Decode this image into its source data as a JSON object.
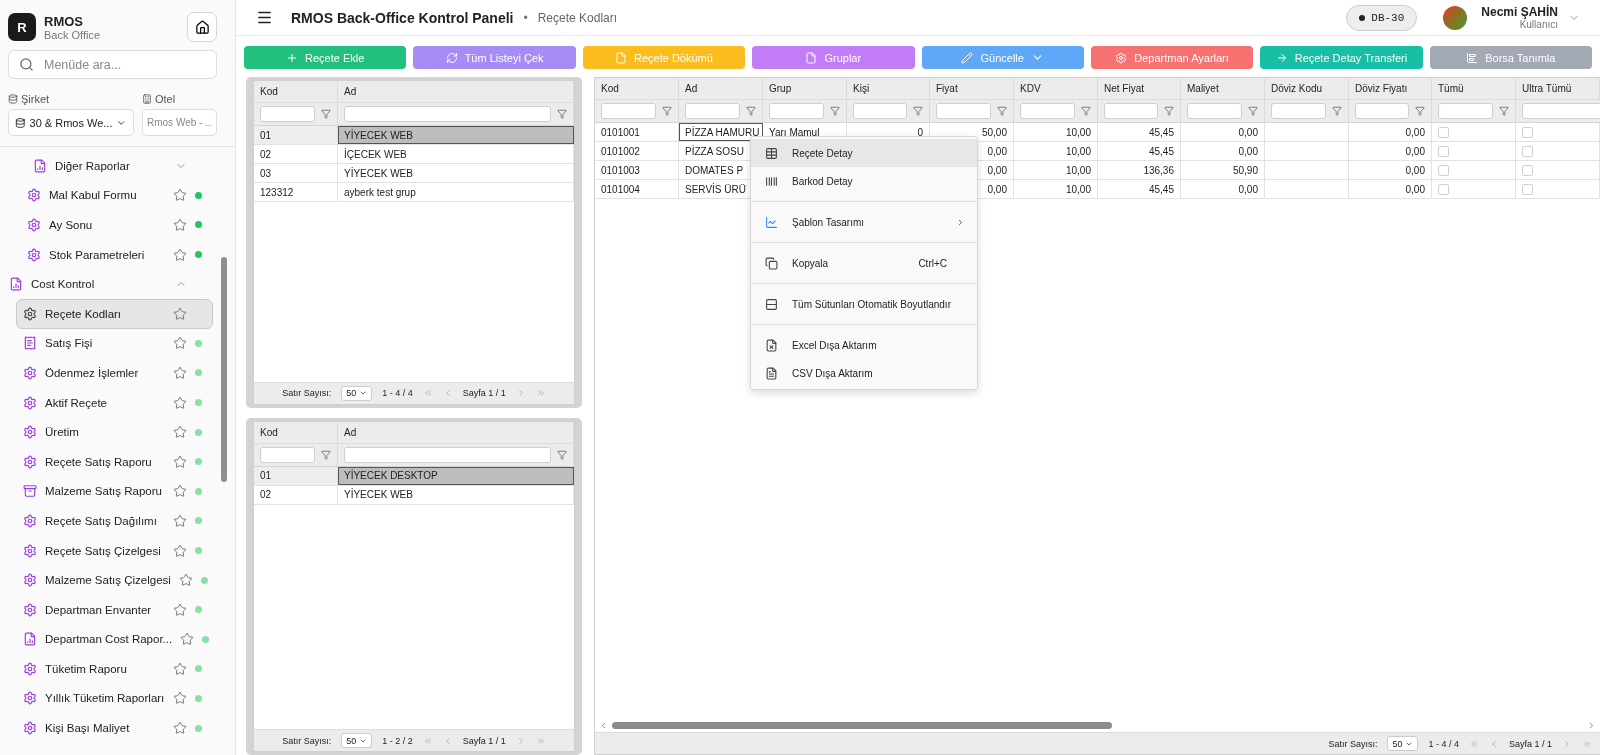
{
  "sidebar": {
    "logo": "R",
    "app_name": "RMOS",
    "app_subtitle": "Back Office",
    "search": {
      "placeholder": "Menüde ara..."
    },
    "company": {
      "label": "Şirket",
      "value": "30 & Rmos We..."
    },
    "hotel": {
      "label": "Otel",
      "placeholder": "Rmos Web - ..."
    },
    "menu": [
      {
        "kind": "submenu",
        "label": "Diğer Raporlar",
        "expanded": false
      },
      {
        "kind": "page",
        "label": "Mal Kabul Formu",
        "color": "#22c55e",
        "selected": false
      },
      {
        "kind": "page",
        "label": "Ay Sonu",
        "color": "#22c55e",
        "selected": false
      },
      {
        "kind": "page",
        "label": "Stok Parametreleri",
        "color": "#22c55e",
        "selected": false
      },
      {
        "kind": "section",
        "label": "Cost Kontrol",
        "expanded": true,
        "children": [
          {
            "kind": "page",
            "label": "Reçete Kodları",
            "selected": true
          },
          {
            "kind": "page",
            "label": "Satış Fişi",
            "color": "#86e0a8",
            "selected": false
          },
          {
            "kind": "page",
            "label": "Ödenmez İşlemler",
            "color": "#86e0a8",
            "selected": false
          },
          {
            "kind": "page",
            "label": "Aktif Reçete",
            "color": "#86e0a8",
            "selected": false
          },
          {
            "kind": "page",
            "label": "Üretim",
            "color": "#86e0a8",
            "selected": false
          },
          {
            "kind": "page",
            "label": "Reçete Satış Raporu",
            "color": "#86e0a8",
            "selected": false
          },
          {
            "kind": "page",
            "label": "Malzeme Satış Raporu",
            "color": "#86e0a8",
            "selected": false
          },
          {
            "kind": "page",
            "label": "Reçete Satış Dağılımı",
            "color": "#86e0a8",
            "selected": false
          },
          {
            "kind": "page",
            "label": "Reçete Satış Çizelgesi",
            "color": "#86e0a8",
            "selected": false
          },
          {
            "kind": "page",
            "label": "Malzeme Satış Çizelgesi",
            "color": "#86e0a8",
            "selected": false
          },
          {
            "kind": "page",
            "label": "Departman Envanter",
            "color": "#86e0a8",
            "selected": false
          },
          {
            "kind": "page",
            "label": "Departman Cost Rapor...",
            "color": "#86e0a8",
            "selected": false
          },
          {
            "kind": "page",
            "label": "Tüketim Raporu",
            "color": "#86e0a8",
            "selected": false
          },
          {
            "kind": "page",
            "label": "Yıllık Tüketim Raporları",
            "color": "#86e0a8",
            "selected": false
          },
          {
            "kind": "page",
            "label": "Kişi Başı Maliyet",
            "color": "#86e0a8",
            "selected": false
          }
        ]
      }
    ]
  },
  "header": {
    "title": "RMOS Back-Office Kontrol Paneli",
    "separator": "•",
    "breadcrumb": "Reçete Kodları",
    "db_badge": "DB-30",
    "user_name": "Necmi ŞAHİN",
    "user_role": "Kullanıcı"
  },
  "toolbar": [
    {
      "label": "Reçete Ekle",
      "color": "#22c07f"
    },
    {
      "label": "Tüm Listeyi Çek",
      "color": "#a68cf5"
    },
    {
      "label": "Reçete Dökümü",
      "color": "#fbbd1e"
    },
    {
      "label": "Gruplar",
      "color": "#c27cf7"
    },
    {
      "label": "Güncelle",
      "color": "#5ea8f7",
      "dropdown": true
    },
    {
      "label": "Departman Ayarları",
      "color": "#f77171"
    },
    {
      "label": "Reçete Detay Transferi",
      "color": "#19bfa5"
    },
    {
      "label": "Borsa Tanımla",
      "color": "#a2a9b4"
    }
  ],
  "groups_grid": {
    "columns": [
      "Kod",
      "Ad"
    ],
    "rows": [
      {
        "cells": [
          "01",
          "YİYECEK WEB"
        ],
        "selected": true
      },
      {
        "cells": [
          "02",
          "İÇECEK WEB"
        ],
        "selected": false
      },
      {
        "cells": [
          "03",
          "YİYECEK WEB"
        ],
        "selected": false
      },
      {
        "cells": [
          "123312",
          "ayberk test grup"
        ],
        "selected": false
      }
    ],
    "pager": {
      "rows_label": "Satır Sayısı:",
      "page_size": "50",
      "range": "1 - 4 / 4",
      "page": "Sayfa 1 / 1"
    }
  },
  "subgroups_grid": {
    "columns": [
      "Kod",
      "Ad"
    ],
    "rows": [
      {
        "cells": [
          "01",
          "YİYECEK DESKTOP"
        ],
        "selected": true
      },
      {
        "cells": [
          "02",
          "YİYECEK WEB"
        ],
        "selected": false
      }
    ],
    "pager": {
      "rows_label": "Satır Sayısı:",
      "page_size": "50",
      "range": "1 - 2 / 2",
      "page": "Sayfa 1 / 1"
    }
  },
  "recipes_grid": {
    "columns": [
      "Kod",
      "Ad",
      "Grup",
      "Kişi",
      "Fiyat",
      "KDV",
      "Net Fiyat",
      "Maliyet",
      "Döviz Kodu",
      "Döviz Fiyatı",
      "Tümü",
      "Ultra Tümü"
    ],
    "rows": [
      {
        "cells": [
          "0101001",
          "PİZZA HAMURU",
          "Yarı Mamul",
          "0",
          "50,00",
          "10,00",
          "45,45",
          "0,00",
          null,
          "0,00"
        ],
        "focused": true,
        "tumu": false,
        "ultra_tumu": false
      },
      {
        "cells": [
          "0101002",
          "PİZZA SOSU",
          null,
          null,
          "0,00",
          "10,00",
          "45,45",
          "0,00",
          null,
          "0,00"
        ],
        "focused": false,
        "tumu": false,
        "ultra_tumu": false
      },
      {
        "cells": [
          "0101003",
          "DOMATES P",
          null,
          null,
          "0,00",
          "10,00",
          "136,36",
          "50,90",
          null,
          "0,00"
        ],
        "focused": false,
        "tumu": false,
        "ultra_tumu": false
      },
      {
        "cells": [
          "0101004",
          "SERVİS ÜRÜ",
          null,
          null,
          "0,00",
          "10,00",
          "45,45",
          "0,00",
          null,
          "0,00"
        ],
        "focused": false,
        "tumu": false,
        "ultra_tumu": false
      }
    ],
    "pager": {
      "rows_label": "Satır Sayısı:",
      "page_size": "50",
      "range": "1 - 4 / 4",
      "page": "Sayfa 1 / 1"
    }
  },
  "context_menu": {
    "groups": [
      [
        {
          "label": "Reçete Detay",
          "selected": true
        },
        {
          "label": "Barkod Detay",
          "selected": false
        }
      ],
      [
        {
          "label": "Şablon Tasarımı",
          "selected": false,
          "submenu": true
        }
      ],
      [
        {
          "label": "Kopyala",
          "selected": false,
          "shortcut": "Ctrl+C"
        }
      ],
      [
        {
          "label": "Tüm Sütunları Otomatik Boyutlandır",
          "selected": false
        }
      ],
      [
        {
          "label": "Excel Dışa Aktarım",
          "selected": false
        },
        {
          "label": "CSV Dışa Aktarım",
          "selected": false
        }
      ]
    ]
  }
}
